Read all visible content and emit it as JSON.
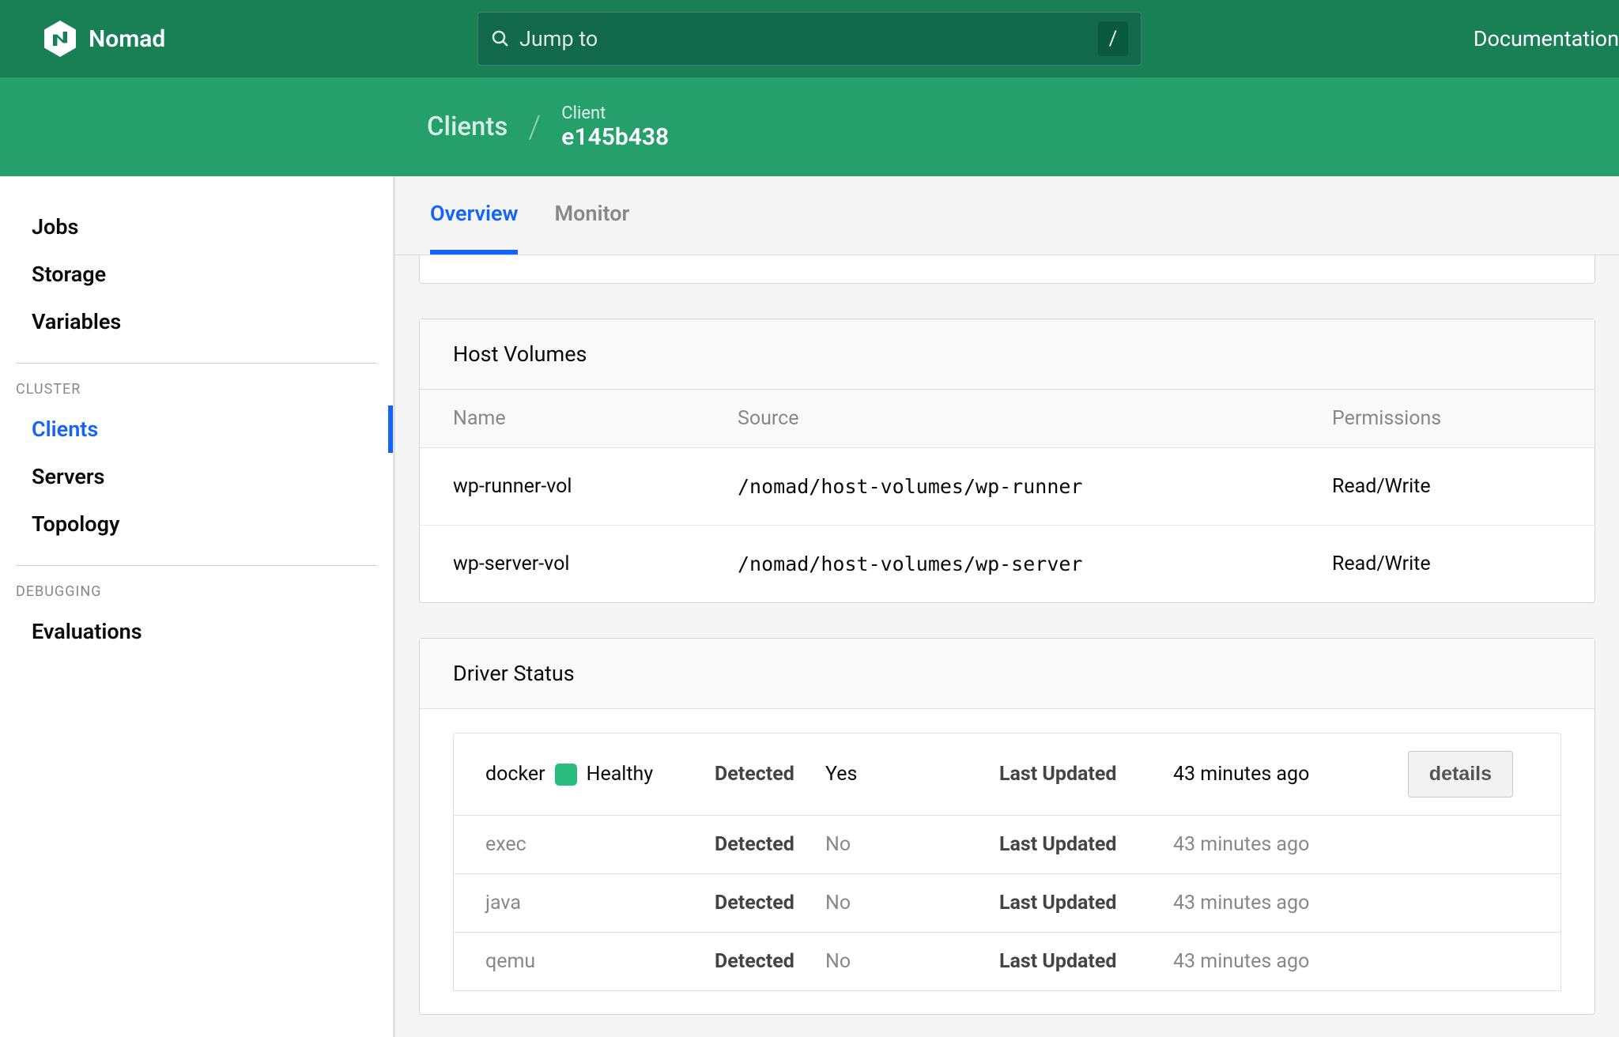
{
  "brand": "Nomad",
  "search": {
    "placeholder": "Jump to",
    "shortcut": "/"
  },
  "topnav": {
    "documentation": "Documentation"
  },
  "breadcrumb": {
    "parent": "Clients",
    "child_label": "Client",
    "child_value": "e145b438"
  },
  "sidebar": {
    "workload": [
      "Jobs",
      "Storage",
      "Variables"
    ],
    "cluster_label": "CLUSTER",
    "cluster": [
      "Clients",
      "Servers",
      "Topology"
    ],
    "debugging_label": "DEBUGGING",
    "debugging": [
      "Evaluations"
    ]
  },
  "tabs": [
    "Overview",
    "Monitor"
  ],
  "host_volumes": {
    "title": "Host Volumes",
    "columns": [
      "Name",
      "Source",
      "Permissions"
    ],
    "rows": [
      {
        "name": "wp-runner-vol",
        "source": "/nomad/host-volumes/wp-runner",
        "perm": "Read/Write"
      },
      {
        "name": "wp-server-vol",
        "source": "/nomad/host-volumes/wp-server",
        "perm": "Read/Write"
      }
    ]
  },
  "driver_status": {
    "title": "Driver Status",
    "detected_label": "Detected",
    "updated_label": "Last Updated",
    "details_button": "details",
    "rows": [
      {
        "name": "docker",
        "healthy": true,
        "health_text": "Healthy",
        "detected": "Yes",
        "updated": "43 minutes ago"
      },
      {
        "name": "exec",
        "healthy": false,
        "detected": "No",
        "updated": "43 minutes ago"
      },
      {
        "name": "java",
        "healthy": false,
        "detected": "No",
        "updated": "43 minutes ago"
      },
      {
        "name": "qemu",
        "healthy": false,
        "detected": "No",
        "updated": "43 minutes ago"
      }
    ]
  }
}
